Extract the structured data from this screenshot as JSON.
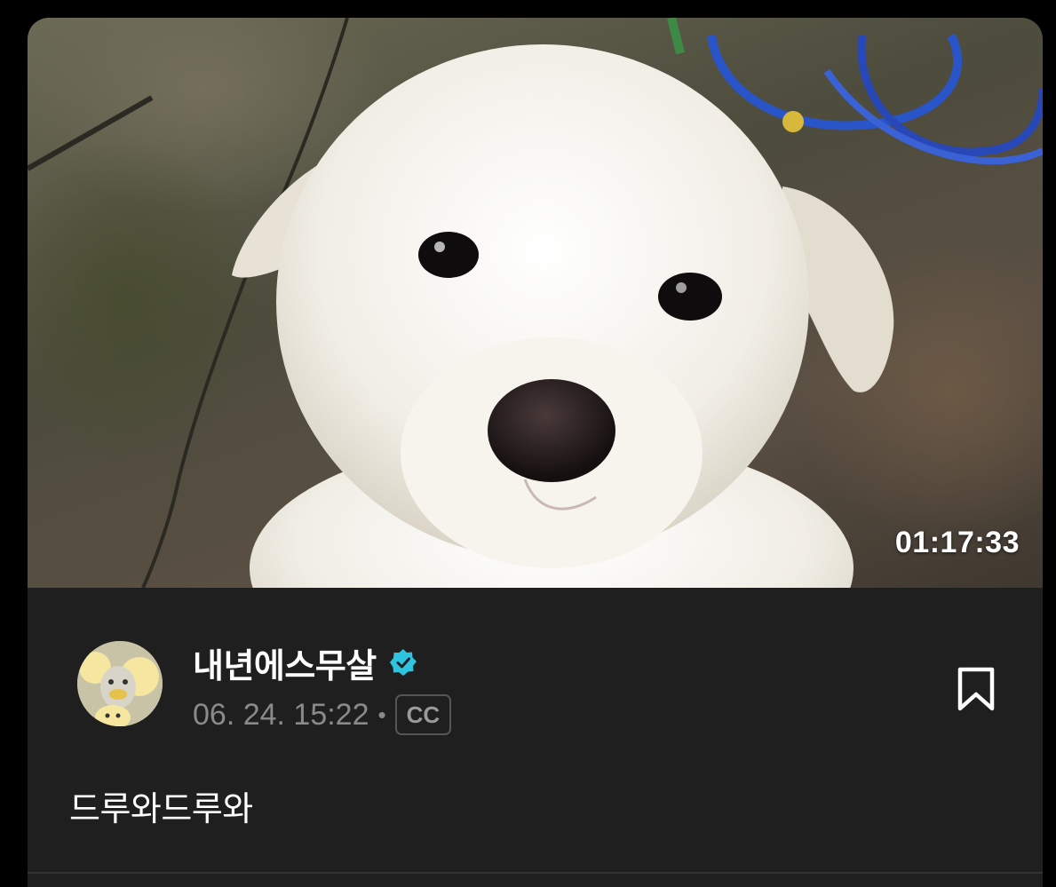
{
  "video": {
    "thumbnail": "white-puppy-photo",
    "duration": "01:17:33"
  },
  "post": {
    "channel_name": "내년에스무살",
    "verified": true,
    "date": "06. 24. 15:22",
    "separator": "•",
    "cc_label": "CC",
    "caption": "드루와드루와"
  },
  "colors": {
    "card_background": "#1f1f1f",
    "verified_badge": "#2ec4e0",
    "meta_text": "#8a8a8a"
  },
  "icons": {
    "verified": "verified-badge-icon",
    "bookmark": "bookmark-icon"
  }
}
